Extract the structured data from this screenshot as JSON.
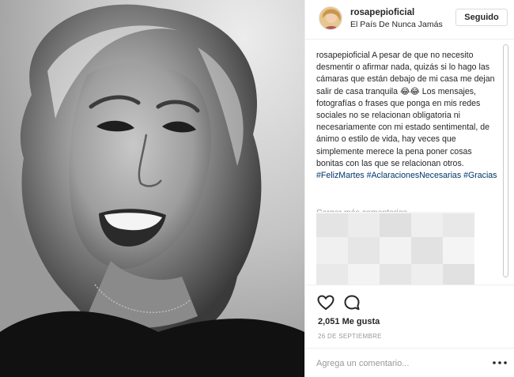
{
  "post": {
    "photo_icon": "portrait-photo",
    "header": {
      "username": "rosapepioficial",
      "location": "El País De Nunca Jamás",
      "follow_label": "Seguido"
    },
    "caption": {
      "author": "rosapepioficial",
      "text": "A pesar de que no necesito desmentir o afirmar nada, quizás si lo hago las cámaras que están debajo de mi casa me dejan salir de casa tranquila 😂😂 Los mensajes, fotografías o frases que ponga en mis redes sociales no se relacionan obligatoria ni necesariamente con mi estado sentimental, de ánimo o estilo de vida, hay veces que simplemente merece la pena poner cosas bonitas con las que se relacionan otros.",
      "hashtags": [
        "#FelizMartes",
        "#AclaracionesNecesarias",
        "#Gracias"
      ]
    },
    "load_more_label": "Cargar más comentarios",
    "actions": {
      "like_icon": "heart-icon",
      "comment_icon": "comment-icon"
    },
    "likes_text": "2,051 Me gusta",
    "date_text": "26 DE SEPTIEMBRE",
    "add_comment": {
      "placeholder": "Agrega un comentario...",
      "more_icon": "more-options-icon"
    },
    "colors": {
      "text": "#262626",
      "muted": "#999999",
      "hashtag": "#003569",
      "border": "#efefef"
    }
  }
}
